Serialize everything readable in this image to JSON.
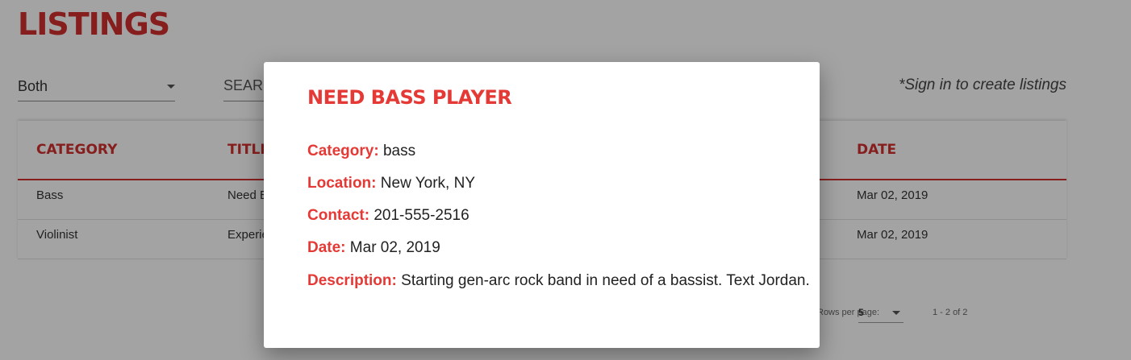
{
  "page": {
    "title": "LISTINGS",
    "filter": {
      "selected": "Both"
    },
    "search": {
      "placeholder": "SEARCH"
    },
    "signin_note": "*Sign in to create listings"
  },
  "table": {
    "headers": {
      "category": "CATEGORY",
      "title": "TITLE",
      "date": "DATE"
    },
    "rows": [
      {
        "category": "Bass",
        "title": "Need Bass Player",
        "date": "Mar 02, 2019"
      },
      {
        "category": "Violinist",
        "title": "Experienced Violinist",
        "date": "Mar 02, 2019"
      }
    ]
  },
  "pagination": {
    "rows_per_page_label": "Rows per page:",
    "rows_per_page": "5",
    "range": "1 - 2 of 2"
  },
  "modal": {
    "title": "NEED BASS PLAYER",
    "fields": [
      {
        "label": "Category:",
        "value": "bass"
      },
      {
        "label": "Location:",
        "value": "New York, NY"
      },
      {
        "label": "Contact:",
        "value": "201-555-2516"
      },
      {
        "label": "Date:",
        "value": "Mar 02, 2019"
      },
      {
        "label": "Description:",
        "value": "Starting gen-arc rock band in need of a bassist. Text Jordan."
      }
    ]
  }
}
